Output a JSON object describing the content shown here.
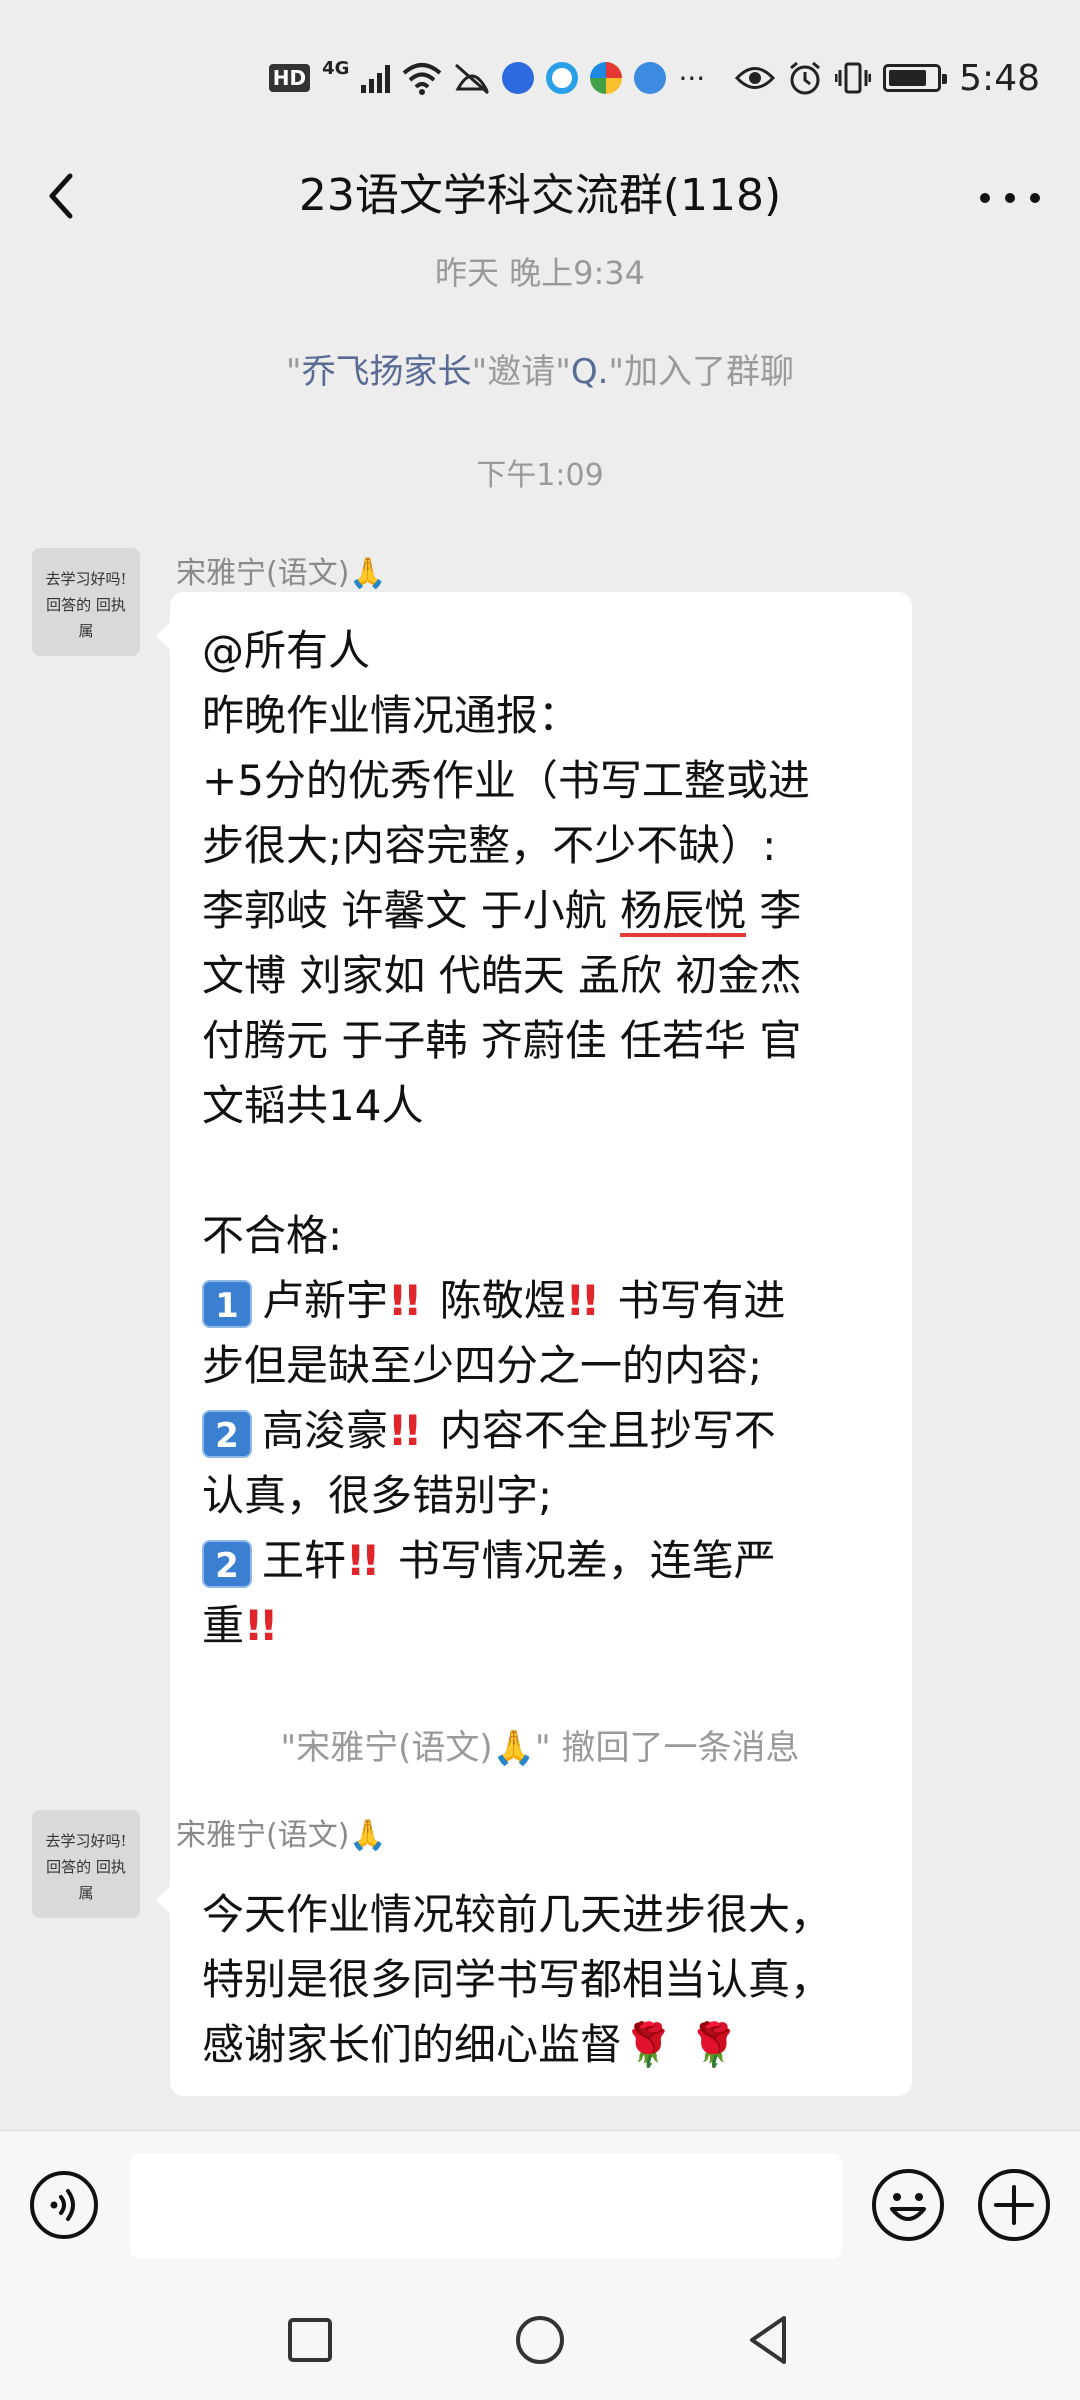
{
  "status_bar": {
    "hd": "HD",
    "network": "4G",
    "more": "···",
    "time": "5:48"
  },
  "header": {
    "title": "23语文学科交流群(118)"
  },
  "chat": {
    "cut_timestamp": "昨天 晚上9:34",
    "join_notice": {
      "q1": "\"",
      "inviter": "乔飞扬家长",
      "q2": "\"邀请\"",
      "invitee": "Q.",
      "q3": "\"加入了群聊"
    },
    "timestamp": "下午1:09",
    "messages": [
      {
        "sender": "宋雅宁(语文)",
        "avatar_text": "去学习好吗!\n回答的 回执属",
        "lines": [
          "@所有人",
          "昨晚作业情况通报：",
          "+5分的优秀作业（书写工整或进",
          "步很大;内容完整，不少不缺）:",
          "李郭岐 许馨文 于小航 ",
          "杨辰悦",
          " 李",
          "文博 刘家如 代皓天 孟欣 初金杰",
          "付腾元 于子韩 齐蔚佳 任若华 官",
          "文韬共14人",
          "不合格:",
          "1",
          "卢新宇",
          "陈敬煜",
          "书写有进",
          "步但是缺至少四分之一的内容;",
          "2",
          "高浚豪",
          "内容不全且抄写不",
          "认真，很多错别字;",
          "2",
          "王轩",
          "书写情况差，连笔严",
          "重"
        ]
      },
      {
        "sender": "宋雅宁(语文)",
        "avatar_text": "去学习好吗!\n回答的 回执属",
        "lines": [
          "今天作业情况较前几天进步很大，",
          "特别是很多同学书写都相当认真，",
          "感谢家长们的细心监督"
        ]
      }
    ],
    "recall_notice": {
      "q1": "\"宋雅宁(语文)",
      "q2": "\" 撤回了一条消息"
    }
  },
  "colors": {
    "background": "#ededed",
    "bubble": "#ffffff",
    "system_text": "#9a9a9a",
    "link_name": "#576b95",
    "alert_red": "#e0262b"
  }
}
